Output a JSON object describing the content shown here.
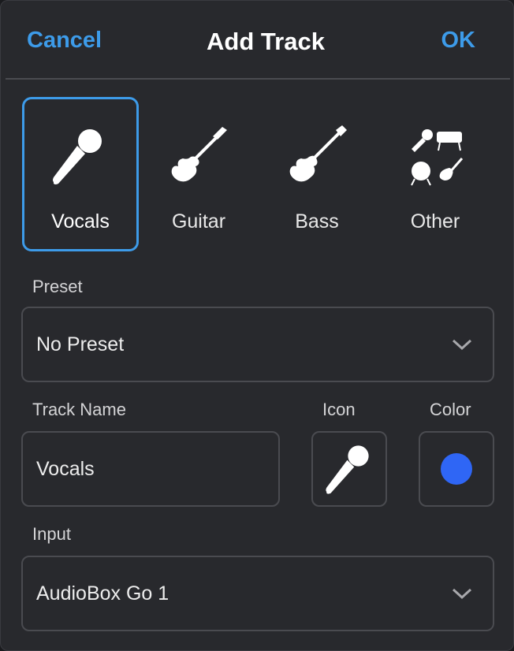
{
  "header": {
    "cancel_label": "Cancel",
    "title": "Add Track",
    "ok_label": "OK"
  },
  "track_types": [
    {
      "label": "Vocals",
      "icon": "microphone-icon",
      "selected": true
    },
    {
      "label": "Guitar",
      "icon": "electric-guitar-icon",
      "selected": false
    },
    {
      "label": "Bass",
      "icon": "bass-guitar-icon",
      "selected": false
    },
    {
      "label": "Other",
      "icon": "other-instruments-icon",
      "selected": false
    }
  ],
  "preset": {
    "label": "Preset",
    "value": "No Preset"
  },
  "track_name": {
    "label": "Track Name",
    "value": "Vocals"
  },
  "icon": {
    "label": "Icon",
    "value": "microphone-icon"
  },
  "color": {
    "label": "Color",
    "value": "#2f66f5"
  },
  "input": {
    "label": "Input",
    "value": "AudioBox Go 1"
  },
  "colors": {
    "accent": "#3d9be9",
    "background": "#28292d",
    "border": "#4a4b50"
  }
}
